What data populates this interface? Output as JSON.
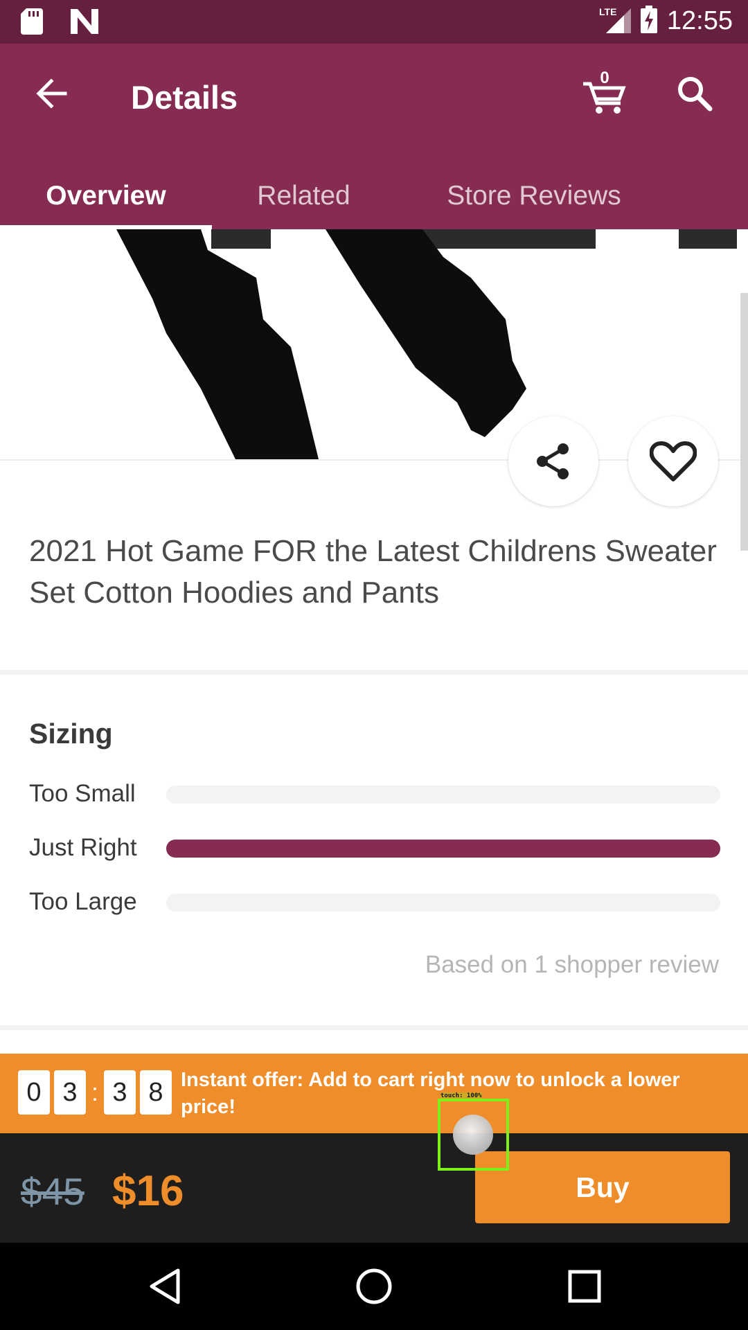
{
  "status_bar": {
    "time": "12:55",
    "network": "LTE",
    "icons": [
      "sd-card-icon",
      "n-notification-icon",
      "signal-icon",
      "battery-charging-icon"
    ]
  },
  "app_bar": {
    "title": "Details",
    "cart_count": "0",
    "icons": [
      "back-arrow-icon",
      "cart-icon",
      "search-icon"
    ]
  },
  "tabs": [
    {
      "label": "Overview",
      "active": true
    },
    {
      "label": "Related",
      "active": false
    },
    {
      "label": "Store Reviews",
      "active": false
    }
  ],
  "product": {
    "title": "2021 Hot Game FOR the Latest Childrens Sweater Set Cotton Hoodies and Pants",
    "actions": [
      "share-icon",
      "heart-icon"
    ]
  },
  "sizing": {
    "title": "Sizing",
    "rows": [
      {
        "label": "Too Small",
        "fraction": 0
      },
      {
        "label": "Just Right",
        "fraction": 1
      },
      {
        "label": "Too Large",
        "fraction": 0
      }
    ],
    "footnote": "Based on 1 shopper review"
  },
  "offer": {
    "countdown": [
      "0",
      "3",
      "3",
      "8"
    ],
    "separator": ":",
    "text": "Instant offer: Add to cart right now to unlock a lower price!"
  },
  "price": {
    "old": "$45",
    "new": "$16",
    "buy_label": "Buy"
  },
  "touch_overlay": {
    "label": "touch: 100%"
  },
  "colors": {
    "brand": "#862b51",
    "status_bar": "#66203f",
    "accent": "#ef8d2b",
    "price_bar": "#1e1e1e"
  }
}
